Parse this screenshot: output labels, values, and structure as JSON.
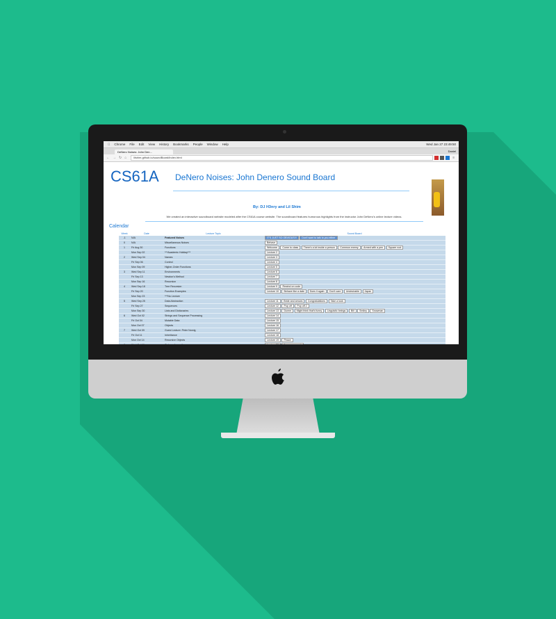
{
  "browser": {
    "menu": [
      "Chrome",
      "File",
      "Edit",
      "View",
      "History",
      "Bookmarks",
      "People",
      "Window",
      "Help"
    ],
    "clock": "Wed Jan 27  23:49:50",
    "tab_title": "DeNero Noises: John Den...",
    "user": "Daniel",
    "url": "lilshim.github.io/soundBoard/index.html"
  },
  "page": {
    "logo": "CS61A",
    "title": "DeNero Noises: John Denero Sound Board",
    "byline": "By: DJ H3nry and Lil Shim",
    "intro": "We created an interactive soundboard website modeled after the CS61A course website. The soundboard features humorous highlights from the instructor John DeNero's online lecture videos.",
    "calendar_heading": "Calendar",
    "columns": [
      "Week",
      "Date",
      "Lecture Topic",
      "Sound Board"
    ]
  },
  "rows": [
    {
      "week": "-1",
      "date": "N/A",
      "topic": "Featured Noises",
      "buttons": [
        "IT'S JUST SO OBVIOUS!!!",
        "Don't want to talk to you either"
      ]
    },
    {
      "week": "0",
      "date": "N/A",
      "topic": "Miscellaneous Noises",
      "buttons": [
        "Behave"
      ]
    },
    {
      "week": "1",
      "date": "Fri Aug 30",
      "topic": "Functions",
      "buttons": [
        "Welcome",
        "Come to class",
        "There's a lot inside a person",
        "Common enemy",
        "Armed with a pen",
        "Square root"
      ]
    },
    {
      "week": "",
      "date": "Mon Sep 02",
      "topic": "***Academic Holiday***",
      "buttons": [
        "Lecture 2"
      ]
    },
    {
      "week": "2",
      "date": "Wed Sep 04",
      "topic": "Names",
      "buttons": [
        "Lecture 3"
      ]
    },
    {
      "week": "",
      "date": "Fri Sep 06",
      "topic": "Control",
      "buttons": [
        "Lecture 4"
      ]
    },
    {
      "week": "",
      "date": "Mon Sep 09",
      "topic": "Higher-Order Functions",
      "buttons": [
        "Lecture 5"
      ]
    },
    {
      "week": "3",
      "date": "Wed Sep 11",
      "topic": "Environments",
      "buttons": [
        "Lecture 6"
      ]
    },
    {
      "week": "",
      "date": "Fri Sep 13",
      "topic": "Newton's Method",
      "buttons": [
        "Lecture 7"
      ]
    },
    {
      "week": "",
      "date": "Mon Sep 16",
      "topic": "Recursion",
      "buttons": [
        "Lecture 8"
      ]
    },
    {
      "week": "4",
      "date": "Wed Sep 18",
      "topic": "Tree Recursion",
      "buttons": [
        "Lecture 9",
        "Rewind on code"
      ]
    },
    {
      "week": "",
      "date": "Fri Sep 20",
      "topic": "Function Examples",
      "buttons": [
        "Lecture 10",
        "Behave like a date",
        "Does it again",
        "Don't care",
        "Undesirable",
        "Japan"
      ]
    },
    {
      "week": "",
      "date": "Mon Sep 23",
      "topic": "***No Lecture",
      "buttons": []
    },
    {
      "week": "5",
      "date": "Wed Sep 25",
      "topic": "Data Abstraction",
      "buttons": [
        "Lecture 11",
        "Bride and arrows",
        "Congratulations",
        "Take a look"
      ]
    },
    {
      "week": "",
      "date": "Fri Sep 27",
      "topic": "Sequences",
      "buttons": [
        "Lecture 12",
        "Pop off",
        "Pop off 2"
      ]
    },
    {
      "week": "",
      "date": "Mon Sep 30",
      "topic": "Lists and Dictionaries",
      "buttons": [
        "Lecture 13",
        "Dumm",
        "Might think that's funny",
        "Linguistic beings",
        "Bill",
        "Smiley",
        "Snowman"
      ]
    },
    {
      "week": "6",
      "date": "Wed Oct 02",
      "topic": "Strings and Sequence Processing",
      "buttons": [
        "Lecture 14"
      ]
    },
    {
      "week": "",
      "date": "Fri Oct 04",
      "topic": "Mutable Data",
      "buttons": [
        "Lecture 15"
      ]
    },
    {
      "week": "",
      "date": "Mon Oct 07",
      "topic": "Objects",
      "buttons": [
        "Lecture 16"
      ]
    },
    {
      "week": "7",
      "date": "Wed Oct 09",
      "topic": "Guest Lecture: Peter Norvig",
      "buttons": [
        "Lecture 17"
      ]
    },
    {
      "week": "",
      "date": "Fri Oct 11",
      "topic": "Inheritance",
      "buttons": [
        "Lecture 18"
      ]
    },
    {
      "week": "",
      "date": "Mon Oct 14",
      "topic": "Recursive Objects",
      "buttons": [
        "Lecture 19",
        "Peace"
      ]
    },
    {
      "week": "8",
      "date": "Wed Oct 16",
      "topic": "Orders of growth",
      "buttons": [
        "Lecture 20",
        "Announcements"
      ]
    }
  ]
}
